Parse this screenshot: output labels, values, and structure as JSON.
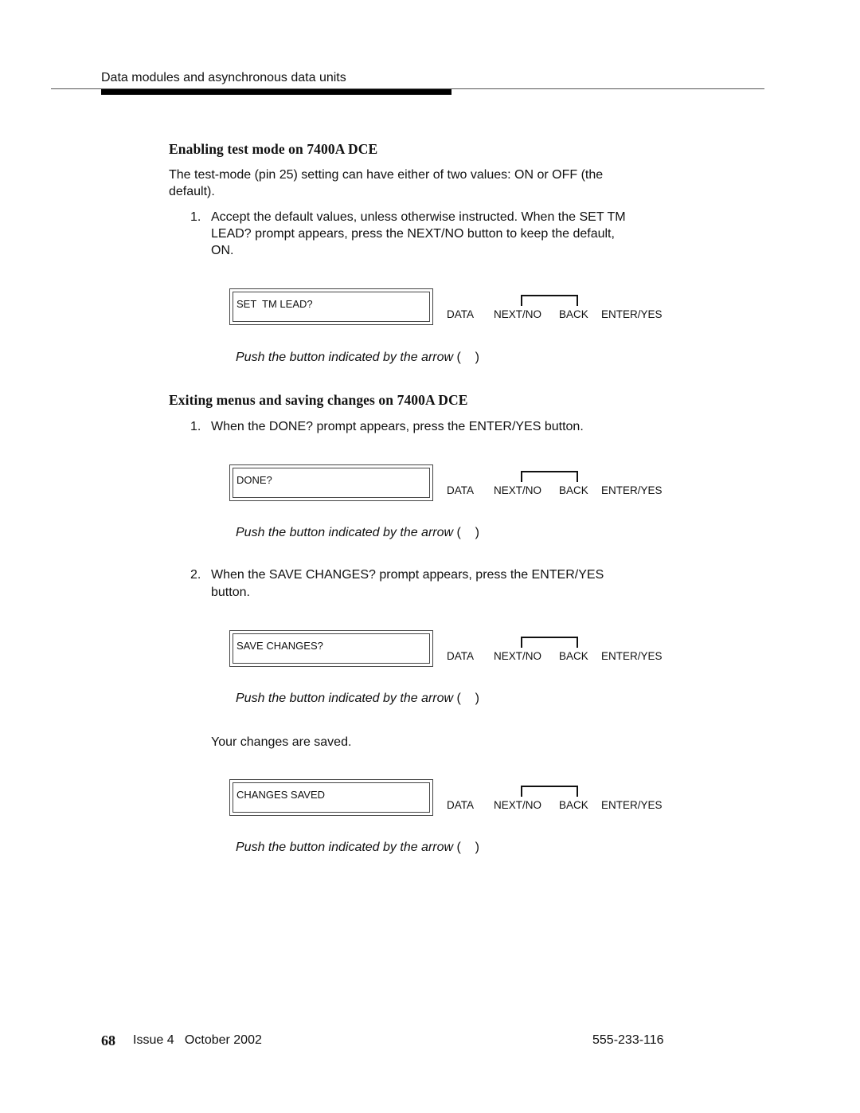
{
  "header": {
    "running_title": "Data modules and asynchronous data units"
  },
  "section1": {
    "heading": "Enabling test mode on 7400A DCE",
    "intro_line1": "The test-mode (pin 25) setting can have either of two values: ON or OFF (the",
    "intro_line2": "default).",
    "steps": [
      {
        "number": "1.",
        "lines": [
          "Accept the default values, unless otherwise instructed. When the SET TM",
          "LEAD?  prompt appears, press the NEXT/NO button to keep the default,",
          "ON."
        ]
      }
    ],
    "panel": {
      "display_text": "SET  TM LEAD?",
      "caption": "Push the button indicated by the arrow",
      "caption_paren": "(    )"
    }
  },
  "section2": {
    "heading": "Exiting menus and saving changes on 7400A DCE",
    "steps": [
      {
        "number": "1.",
        "lines": [
          "When the DONE? prompt appears, press the ENTER/YES button."
        ]
      },
      {
        "number": "2.",
        "lines": [
          "When the SAVE CHANGES? prompt appears, press the ENTER/YES",
          "button."
        ]
      }
    ],
    "panels": [
      {
        "display_text": "DONE?",
        "caption": "Push the button indicated by the arrow",
        "caption_paren": "(    )"
      },
      {
        "display_text": "SAVE CHANGES?",
        "caption": "Push the button indicated by the arrow",
        "caption_paren": "(    )"
      },
      {
        "display_text": "CHANGES SAVED",
        "caption": "Push the button indicated by the arrow",
        "caption_paren": "(    )"
      }
    ],
    "saved_note": "Your changes are saved."
  },
  "buttons": {
    "data": "DATA",
    "next_no": "NEXT/NO",
    "back": "BACK",
    "enter_yes": "ENTER/YES"
  },
  "footer": {
    "page_number": "68",
    "issue": "Issue 4   October 2002",
    "doc_number": "555-233-116"
  }
}
